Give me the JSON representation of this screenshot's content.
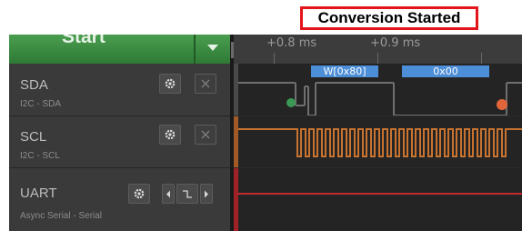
{
  "annotation": {
    "text": "Conversion Started",
    "border_color": "#e3141b"
  },
  "toolbar": {
    "start_label": "Start"
  },
  "timebar": {
    "tick_labels": [
      "+0.8 ms",
      "+0.9 ms"
    ]
  },
  "channels": [
    {
      "name": "SDA",
      "subtitle": "I2C - SDA",
      "trace_color": "#6f6f6f"
    },
    {
      "name": "SCL",
      "subtitle": "I2C - SCL",
      "trace_color": "#c8732f"
    },
    {
      "name": "UART",
      "subtitle": "Async Serial - Serial",
      "trace_color": "#c22a2f"
    }
  ],
  "decoded": [
    {
      "text": "W[0x80]"
    },
    {
      "text": "0x00"
    }
  ],
  "markers": {
    "start_color": "#3a9a55",
    "stop_color": "#e0653a"
  },
  "colors": {
    "accent_green": "#3d8c43",
    "protocol_blue": "#4d8ed8"
  }
}
